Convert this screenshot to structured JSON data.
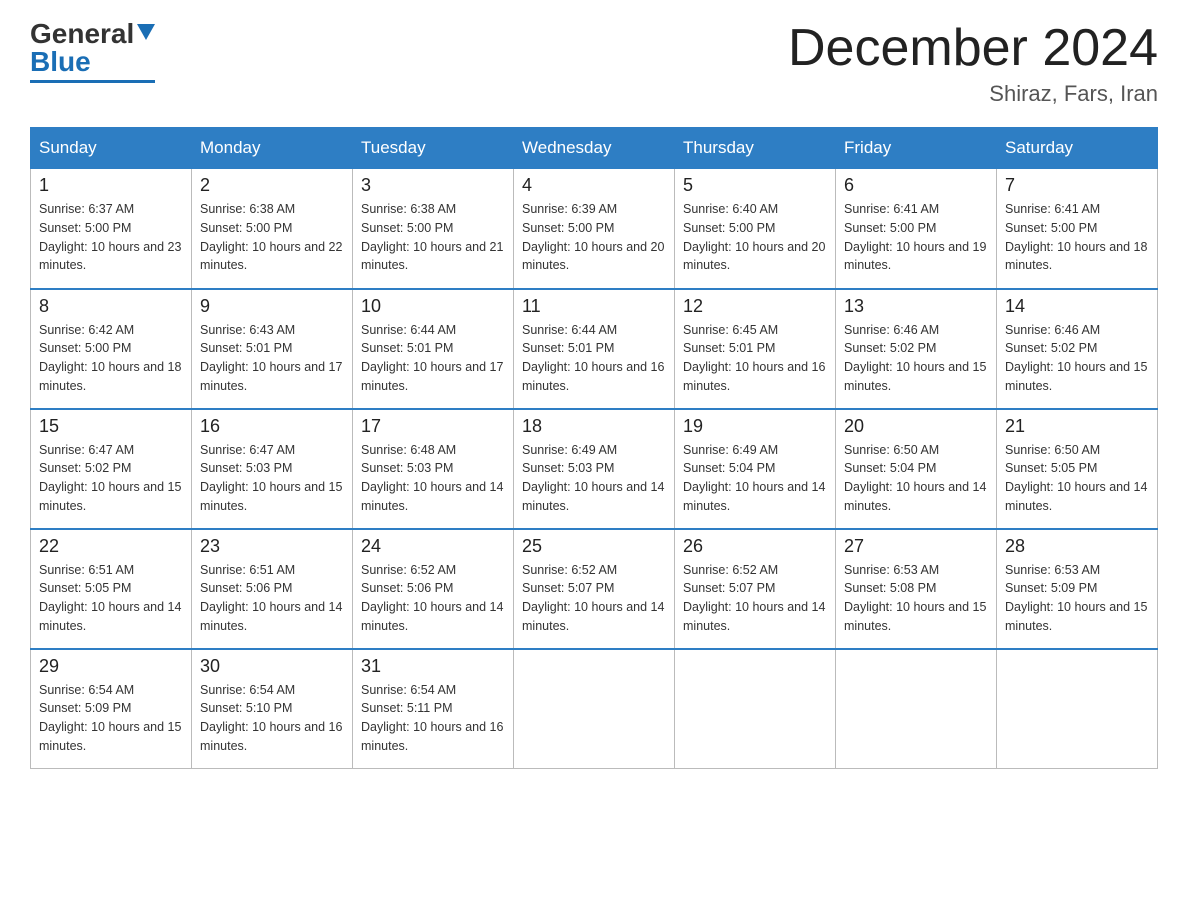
{
  "header": {
    "logo_general": "General",
    "logo_blue": "Blue",
    "month_title": "December 2024",
    "location": "Shiraz, Fars, Iran"
  },
  "days_of_week": [
    "Sunday",
    "Monday",
    "Tuesday",
    "Wednesday",
    "Thursday",
    "Friday",
    "Saturday"
  ],
  "weeks": [
    [
      {
        "day": "1",
        "sunrise": "6:37 AM",
        "sunset": "5:00 PM",
        "daylight": "10 hours and 23 minutes."
      },
      {
        "day": "2",
        "sunrise": "6:38 AM",
        "sunset": "5:00 PM",
        "daylight": "10 hours and 22 minutes."
      },
      {
        "day": "3",
        "sunrise": "6:38 AM",
        "sunset": "5:00 PM",
        "daylight": "10 hours and 21 minutes."
      },
      {
        "day": "4",
        "sunrise": "6:39 AM",
        "sunset": "5:00 PM",
        "daylight": "10 hours and 20 minutes."
      },
      {
        "day": "5",
        "sunrise": "6:40 AM",
        "sunset": "5:00 PM",
        "daylight": "10 hours and 20 minutes."
      },
      {
        "day": "6",
        "sunrise": "6:41 AM",
        "sunset": "5:00 PM",
        "daylight": "10 hours and 19 minutes."
      },
      {
        "day": "7",
        "sunrise": "6:41 AM",
        "sunset": "5:00 PM",
        "daylight": "10 hours and 18 minutes."
      }
    ],
    [
      {
        "day": "8",
        "sunrise": "6:42 AM",
        "sunset": "5:00 PM",
        "daylight": "10 hours and 18 minutes."
      },
      {
        "day": "9",
        "sunrise": "6:43 AM",
        "sunset": "5:01 PM",
        "daylight": "10 hours and 17 minutes."
      },
      {
        "day": "10",
        "sunrise": "6:44 AM",
        "sunset": "5:01 PM",
        "daylight": "10 hours and 17 minutes."
      },
      {
        "day": "11",
        "sunrise": "6:44 AM",
        "sunset": "5:01 PM",
        "daylight": "10 hours and 16 minutes."
      },
      {
        "day": "12",
        "sunrise": "6:45 AM",
        "sunset": "5:01 PM",
        "daylight": "10 hours and 16 minutes."
      },
      {
        "day": "13",
        "sunrise": "6:46 AM",
        "sunset": "5:02 PM",
        "daylight": "10 hours and 15 minutes."
      },
      {
        "day": "14",
        "sunrise": "6:46 AM",
        "sunset": "5:02 PM",
        "daylight": "10 hours and 15 minutes."
      }
    ],
    [
      {
        "day": "15",
        "sunrise": "6:47 AM",
        "sunset": "5:02 PM",
        "daylight": "10 hours and 15 minutes."
      },
      {
        "day": "16",
        "sunrise": "6:47 AM",
        "sunset": "5:03 PM",
        "daylight": "10 hours and 15 minutes."
      },
      {
        "day": "17",
        "sunrise": "6:48 AM",
        "sunset": "5:03 PM",
        "daylight": "10 hours and 14 minutes."
      },
      {
        "day": "18",
        "sunrise": "6:49 AM",
        "sunset": "5:03 PM",
        "daylight": "10 hours and 14 minutes."
      },
      {
        "day": "19",
        "sunrise": "6:49 AM",
        "sunset": "5:04 PM",
        "daylight": "10 hours and 14 minutes."
      },
      {
        "day": "20",
        "sunrise": "6:50 AM",
        "sunset": "5:04 PM",
        "daylight": "10 hours and 14 minutes."
      },
      {
        "day": "21",
        "sunrise": "6:50 AM",
        "sunset": "5:05 PM",
        "daylight": "10 hours and 14 minutes."
      }
    ],
    [
      {
        "day": "22",
        "sunrise": "6:51 AM",
        "sunset": "5:05 PM",
        "daylight": "10 hours and 14 minutes."
      },
      {
        "day": "23",
        "sunrise": "6:51 AM",
        "sunset": "5:06 PM",
        "daylight": "10 hours and 14 minutes."
      },
      {
        "day": "24",
        "sunrise": "6:52 AM",
        "sunset": "5:06 PM",
        "daylight": "10 hours and 14 minutes."
      },
      {
        "day": "25",
        "sunrise": "6:52 AM",
        "sunset": "5:07 PM",
        "daylight": "10 hours and 14 minutes."
      },
      {
        "day": "26",
        "sunrise": "6:52 AM",
        "sunset": "5:07 PM",
        "daylight": "10 hours and 14 minutes."
      },
      {
        "day": "27",
        "sunrise": "6:53 AM",
        "sunset": "5:08 PM",
        "daylight": "10 hours and 15 minutes."
      },
      {
        "day": "28",
        "sunrise": "6:53 AM",
        "sunset": "5:09 PM",
        "daylight": "10 hours and 15 minutes."
      }
    ],
    [
      {
        "day": "29",
        "sunrise": "6:54 AM",
        "sunset": "5:09 PM",
        "daylight": "10 hours and 15 minutes."
      },
      {
        "day": "30",
        "sunrise": "6:54 AM",
        "sunset": "5:10 PM",
        "daylight": "10 hours and 16 minutes."
      },
      {
        "day": "31",
        "sunrise": "6:54 AM",
        "sunset": "5:11 PM",
        "daylight": "10 hours and 16 minutes."
      },
      null,
      null,
      null,
      null
    ]
  ],
  "labels": {
    "sunrise_prefix": "Sunrise: ",
    "sunset_prefix": "Sunset: ",
    "daylight_prefix": "Daylight: "
  }
}
